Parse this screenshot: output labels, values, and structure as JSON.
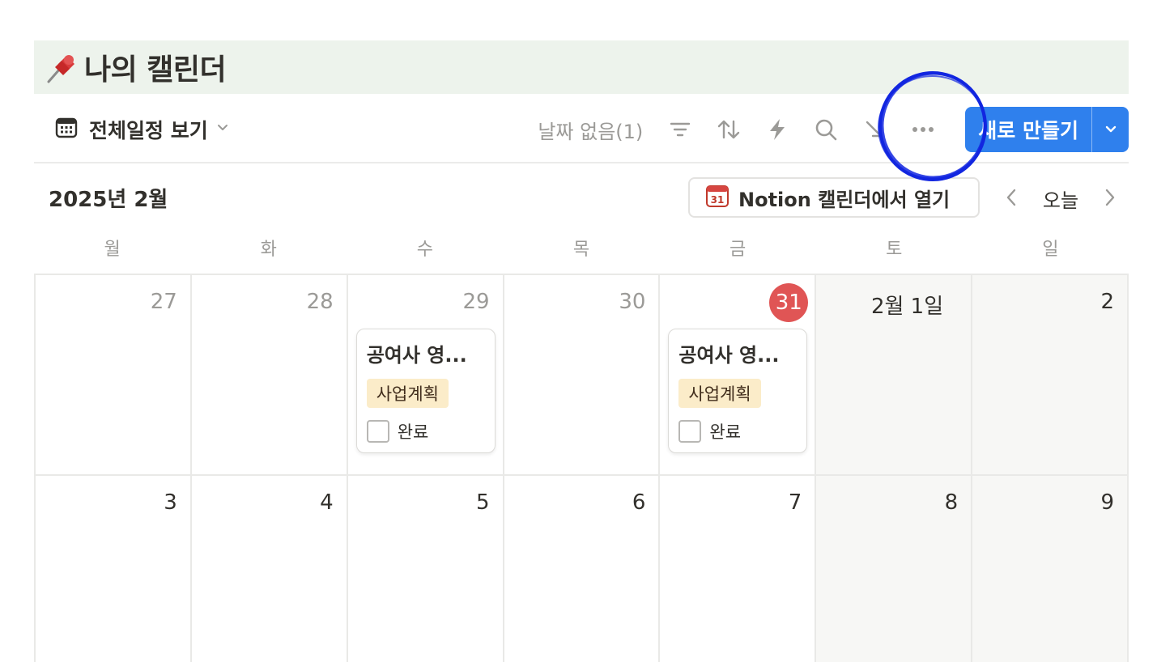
{
  "page": {
    "title": "나의 캘린더",
    "icon": "pushpin-icon"
  },
  "toolbar": {
    "view_label": "전체일정 보기",
    "view_icon": "calendar-icon",
    "no_date_label": "날짜 없음(1)",
    "icons": [
      "filter-icon",
      "sort-icon",
      "lightning-icon",
      "search-icon",
      "resize-arrow-icon",
      "more-icon"
    ],
    "new_button_label": "새로 만들기",
    "accent_color": "#2f80ed"
  },
  "calendar": {
    "month_label": "2025년 2월",
    "open_in_notion_label": "Notion 캘린더에서 열기",
    "today_label": "오늘",
    "weekdays": [
      "월",
      "화",
      "수",
      "목",
      "금",
      "토",
      "일"
    ],
    "weeks": [
      [
        {
          "day": "27"
        },
        {
          "day": "28"
        },
        {
          "day": "29"
        },
        {
          "day": "30"
        },
        {
          "day": "31"
        },
        {
          "day": "2월 1일"
        },
        {
          "day": "2"
        }
      ],
      [
        {
          "day": "3"
        },
        {
          "day": "4"
        },
        {
          "day": "5"
        },
        {
          "day": "6"
        },
        {
          "day": "7"
        },
        {
          "day": "8"
        },
        {
          "day": "9"
        }
      ]
    ],
    "events": [
      {
        "title": "공여사 영...",
        "tag": "사업계획",
        "check_label": "완료",
        "checked": false
      },
      {
        "title": "공여사 영...",
        "tag": "사업계획",
        "check_label": "완료",
        "checked": false
      }
    ],
    "today_color": "#e05555",
    "tag_color": "#fbecc9"
  }
}
